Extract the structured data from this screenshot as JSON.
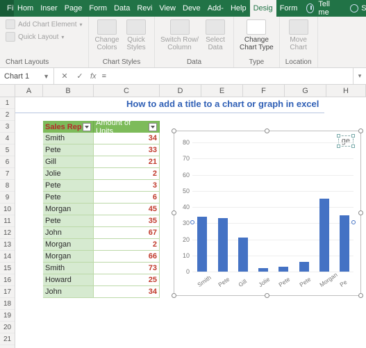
{
  "menu": {
    "file": "File",
    "tabs": [
      "Hom",
      "Inser",
      "Page",
      "Form",
      "Data",
      "Revi",
      "View",
      "Deve",
      "Add-",
      "Help",
      "Desig",
      "Form"
    ],
    "active_index": 10,
    "tellme": "Tell me",
    "share": "Share"
  },
  "ribbon": {
    "chart_layouts": {
      "add_element": "Add Chart Element",
      "quick_layout": "Quick Layout",
      "label": "Chart Layouts"
    },
    "chart_styles": {
      "change_colors": "Change\nColors",
      "quick_styles": "Quick\nStyles",
      "label": "Chart Styles"
    },
    "data": {
      "switch": "Switch Row/\nColumn",
      "select": "Select\nData",
      "label": "Data"
    },
    "type": {
      "change": "Change\nChart Type",
      "label": "Type"
    },
    "location": {
      "move": "Move\nChart",
      "label": "Location"
    }
  },
  "formula_bar": {
    "name_box": "Chart 1",
    "fx": "fx",
    "value": "="
  },
  "columns": [
    "A",
    "B",
    "C",
    "D",
    "E",
    "F",
    "G",
    "H"
  ],
  "rows": [
    "1",
    "2",
    "3",
    "4",
    "5",
    "6",
    "7",
    "8",
    "9",
    "10",
    "11",
    "12",
    "13",
    "14",
    "15",
    "16",
    "17",
    "18",
    "19",
    "20",
    "21"
  ],
  "page_title": "How to add a title to a chart or graph in excel",
  "table": {
    "headers": {
      "rep": "Sales Rep",
      "units": "Amount of Units"
    },
    "rows": [
      {
        "rep": "Smith",
        "units": "34"
      },
      {
        "rep": "Pete",
        "units": "33"
      },
      {
        "rep": "Gill",
        "units": "21"
      },
      {
        "rep": "Jolie",
        "units": "2"
      },
      {
        "rep": "Pete",
        "units": "3"
      },
      {
        "rep": "Pete",
        "units": "6"
      },
      {
        "rep": "Morgan",
        "units": "45"
      },
      {
        "rep": "Pete",
        "units": "35"
      },
      {
        "rep": "John",
        "units": "67"
      },
      {
        "rep": "Morgan",
        "units": "2"
      },
      {
        "rep": "Morgan",
        "units": "66"
      },
      {
        "rep": "Smith",
        "units": "73"
      },
      {
        "rep": "Howard",
        "units": "25"
      },
      {
        "rep": "John",
        "units": "34"
      }
    ]
  },
  "chart_title_text": "ge",
  "chart_data": {
    "type": "bar",
    "categories": [
      "Smith",
      "Pete",
      "Gill",
      "Jolie",
      "Pete",
      "Pete",
      "Morgan",
      "Pe"
    ],
    "values": [
      34,
      33,
      21,
      2,
      3,
      6,
      45,
      35
    ],
    "ylim": [
      0,
      80
    ],
    "yticks": [
      0,
      10,
      20,
      30,
      40,
      50,
      60,
      70,
      80
    ],
    "title": "ge",
    "xlabel": "",
    "ylabel": ""
  }
}
